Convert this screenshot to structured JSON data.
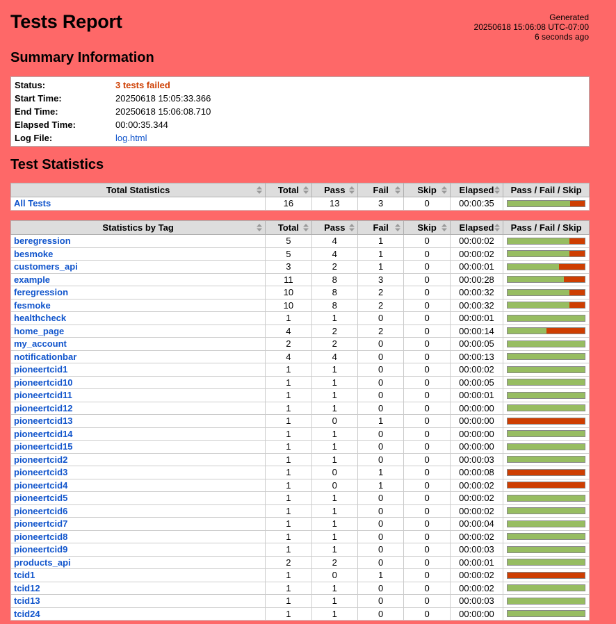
{
  "report": {
    "title": "Tests Report",
    "generated_label": "Generated",
    "generated_time": "20250618 15:06:08 UTC-07:00",
    "generated_ago": "6 seconds ago"
  },
  "summary": {
    "heading": "Summary Information",
    "rows": [
      {
        "key": "Status:",
        "value": "3 tests failed"
      },
      {
        "key": "Start Time:",
        "value": "20250618 15:05:33.366"
      },
      {
        "key": "End Time:",
        "value": "20250618 15:06:08.710"
      },
      {
        "key": "Elapsed Time:",
        "value": "00:00:35.344"
      },
      {
        "key": "Log File:",
        "value": "log.html"
      }
    ]
  },
  "stats": {
    "heading": "Test Statistics",
    "columns": [
      "Total",
      "Pass",
      "Fail",
      "Skip",
      "Elapsed",
      "Pass / Fail / Skip"
    ],
    "total_heading": "Total Statistics",
    "tag_heading": "Statistics by Tag",
    "totals": [
      {
        "name": "All Tests",
        "total": 16,
        "pass": 13,
        "fail": 3,
        "skip": 0,
        "elapsed": "00:00:35"
      }
    ],
    "tags": [
      {
        "name": "beregression",
        "total": 5,
        "pass": 4,
        "fail": 1,
        "skip": 0,
        "elapsed": "00:00:02"
      },
      {
        "name": "besmoke",
        "total": 5,
        "pass": 4,
        "fail": 1,
        "skip": 0,
        "elapsed": "00:00:02"
      },
      {
        "name": "customers_api",
        "total": 3,
        "pass": 2,
        "fail": 1,
        "skip": 0,
        "elapsed": "00:00:01"
      },
      {
        "name": "example",
        "total": 11,
        "pass": 8,
        "fail": 3,
        "skip": 0,
        "elapsed": "00:00:28"
      },
      {
        "name": "feregression",
        "total": 10,
        "pass": 8,
        "fail": 2,
        "skip": 0,
        "elapsed": "00:00:32"
      },
      {
        "name": "fesmoke",
        "total": 10,
        "pass": 8,
        "fail": 2,
        "skip": 0,
        "elapsed": "00:00:32"
      },
      {
        "name": "healthcheck",
        "total": 1,
        "pass": 1,
        "fail": 0,
        "skip": 0,
        "elapsed": "00:00:01"
      },
      {
        "name": "home_page",
        "total": 4,
        "pass": 2,
        "fail": 2,
        "skip": 0,
        "elapsed": "00:00:14"
      },
      {
        "name": "my_account",
        "total": 2,
        "pass": 2,
        "fail": 0,
        "skip": 0,
        "elapsed": "00:00:05"
      },
      {
        "name": "notificationbar",
        "total": 4,
        "pass": 4,
        "fail": 0,
        "skip": 0,
        "elapsed": "00:00:13"
      },
      {
        "name": "pioneertcid1",
        "total": 1,
        "pass": 1,
        "fail": 0,
        "skip": 0,
        "elapsed": "00:00:02"
      },
      {
        "name": "pioneertcid10",
        "total": 1,
        "pass": 1,
        "fail": 0,
        "skip": 0,
        "elapsed": "00:00:05"
      },
      {
        "name": "pioneertcid11",
        "total": 1,
        "pass": 1,
        "fail": 0,
        "skip": 0,
        "elapsed": "00:00:01"
      },
      {
        "name": "pioneertcid12",
        "total": 1,
        "pass": 1,
        "fail": 0,
        "skip": 0,
        "elapsed": "00:00:00"
      },
      {
        "name": "pioneertcid13",
        "total": 1,
        "pass": 0,
        "fail": 1,
        "skip": 0,
        "elapsed": "00:00:00"
      },
      {
        "name": "pioneertcid14",
        "total": 1,
        "pass": 1,
        "fail": 0,
        "skip": 0,
        "elapsed": "00:00:00"
      },
      {
        "name": "pioneertcid15",
        "total": 1,
        "pass": 1,
        "fail": 0,
        "skip": 0,
        "elapsed": "00:00:00"
      },
      {
        "name": "pioneertcid2",
        "total": 1,
        "pass": 1,
        "fail": 0,
        "skip": 0,
        "elapsed": "00:00:03"
      },
      {
        "name": "pioneertcid3",
        "total": 1,
        "pass": 0,
        "fail": 1,
        "skip": 0,
        "elapsed": "00:00:08"
      },
      {
        "name": "pioneertcid4",
        "total": 1,
        "pass": 0,
        "fail": 1,
        "skip": 0,
        "elapsed": "00:00:02"
      },
      {
        "name": "pioneertcid5",
        "total": 1,
        "pass": 1,
        "fail": 0,
        "skip": 0,
        "elapsed": "00:00:02"
      },
      {
        "name": "pioneertcid6",
        "total": 1,
        "pass": 1,
        "fail": 0,
        "skip": 0,
        "elapsed": "00:00:02"
      },
      {
        "name": "pioneertcid7",
        "total": 1,
        "pass": 1,
        "fail": 0,
        "skip": 0,
        "elapsed": "00:00:04"
      },
      {
        "name": "pioneertcid8",
        "total": 1,
        "pass": 1,
        "fail": 0,
        "skip": 0,
        "elapsed": "00:00:02"
      },
      {
        "name": "pioneertcid9",
        "total": 1,
        "pass": 1,
        "fail": 0,
        "skip": 0,
        "elapsed": "00:00:03"
      },
      {
        "name": "products_api",
        "total": 2,
        "pass": 2,
        "fail": 0,
        "skip": 0,
        "elapsed": "00:00:01"
      },
      {
        "name": "tcid1",
        "total": 1,
        "pass": 0,
        "fail": 1,
        "skip": 0,
        "elapsed": "00:00:02"
      },
      {
        "name": "tcid12",
        "total": 1,
        "pass": 1,
        "fail": 0,
        "skip": 0,
        "elapsed": "00:00:02"
      },
      {
        "name": "tcid13",
        "total": 1,
        "pass": 1,
        "fail": 0,
        "skip": 0,
        "elapsed": "00:00:03"
      },
      {
        "name": "tcid24",
        "total": 1,
        "pass": 1,
        "fail": 0,
        "skip": 0,
        "elapsed": "00:00:00"
      }
    ]
  },
  "colors": {
    "background_fail": "#fe6868",
    "pass": "#97bd61",
    "fail": "#ce3e01",
    "skip": "#fed84f",
    "link": "#1155cc"
  },
  "icons": {
    "sort": "sort-icon"
  }
}
